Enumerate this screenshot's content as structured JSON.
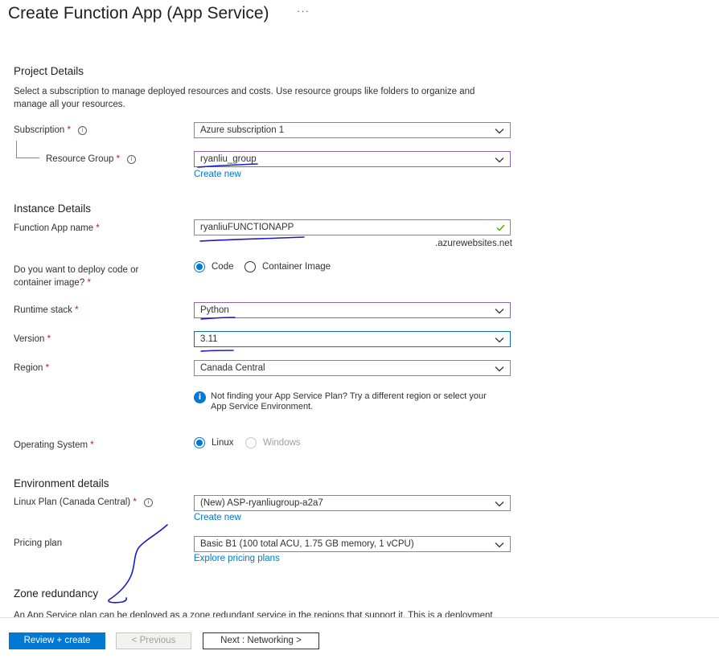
{
  "page": {
    "title": "Create Function App (App Service)",
    "more_menu": "···"
  },
  "project": {
    "heading": "Project Details",
    "description": "Select a subscription to manage deployed resources and costs. Use resource groups like folders to organize and manage all your resources.",
    "subscription_label": "Subscription",
    "subscription_value": "Azure subscription 1",
    "resource_group_label": "Resource Group",
    "resource_group_value": "ryanliu_group",
    "create_new": "Create new"
  },
  "instance": {
    "heading": "Instance Details",
    "app_name_label": "Function App name",
    "app_name_value": "ryanliuFUNCTIONAPP",
    "domain_suffix": ".azurewebsites.net",
    "deploy_label": "Do you want to deploy code or container image?",
    "deploy_options": [
      "Code",
      "Container Image"
    ],
    "deploy_selected": "Code",
    "runtime_label": "Runtime stack",
    "runtime_value": "Python",
    "version_label": "Version",
    "version_value": "3.11",
    "region_label": "Region",
    "region_value": "Canada Central",
    "info_message": "Not finding your App Service Plan? Try a different region or select your App Service Environment.",
    "os_label": "Operating System",
    "os_options": [
      "Linux",
      "Windows"
    ],
    "os_selected": "Linux"
  },
  "environment": {
    "heading": "Environment details",
    "plan_label": "Linux Plan (Canada Central)",
    "plan_value": "(New) ASP-ryanliugroup-a2a7",
    "create_new": "Create new",
    "pricing_label": "Pricing plan",
    "pricing_value": "Basic B1 (100 total ACU, 1.75 GB memory, 1 vCPU)",
    "explore_link": "Explore pricing plans"
  },
  "zone": {
    "heading": "Zone redundancy",
    "description": "An App Service plan can be deployed as a zone redundant service in the regions that support it. This is a deployment"
  },
  "footer": {
    "review_create": "Review + create",
    "previous": "< Previous",
    "next": "Next : Networking >"
  },
  "required_mark": "*",
  "colors": {
    "accent": "#0078d4",
    "required": "#a4262c",
    "valid_check": "#57a300",
    "highlight_border": "#8764b8",
    "annotation_ink": "#1a1ac8"
  }
}
